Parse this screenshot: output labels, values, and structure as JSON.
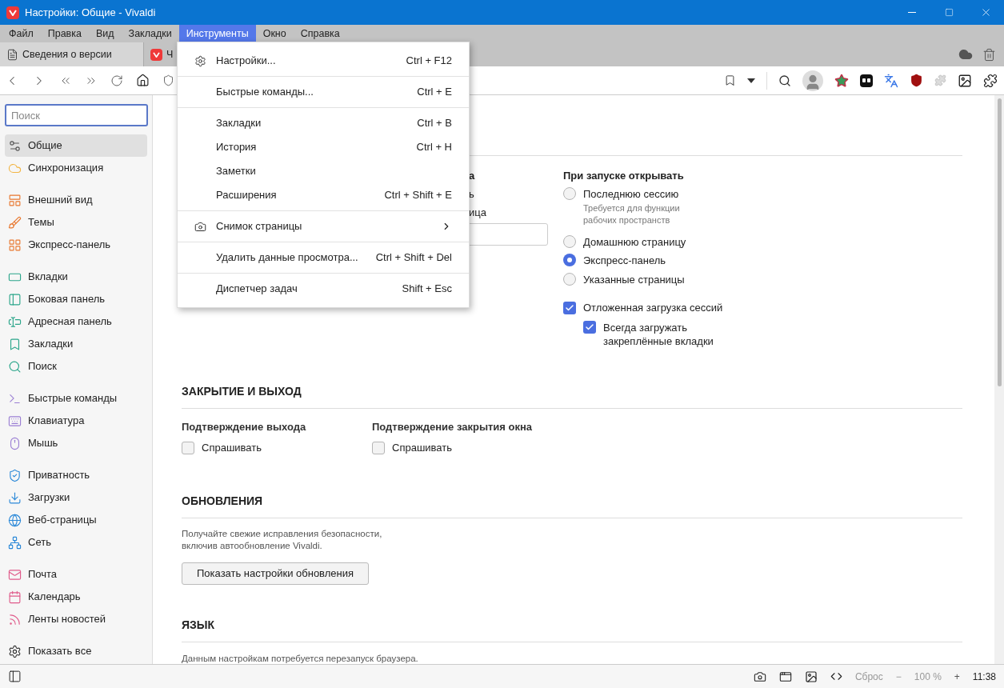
{
  "window": {
    "title": "Настройки: Общие - Vivaldi"
  },
  "menubar": [
    {
      "label": "Файл",
      "selected": false
    },
    {
      "label": "Правка",
      "selected": false
    },
    {
      "label": "Вид",
      "selected": false
    },
    {
      "label": "Закладки",
      "selected": false
    },
    {
      "label": "Инструменты",
      "selected": true
    },
    {
      "label": "Окно",
      "selected": false
    },
    {
      "label": "Справка",
      "selected": false
    }
  ],
  "tabs": [
    {
      "label": "Сведения о версии",
      "kind": "page",
      "selected": true
    },
    {
      "label": "Ч",
      "kind": "vivaldi",
      "selected": false
    }
  ],
  "menu": {
    "groups": [
      [
        {
          "label": "Настройки...",
          "shortcut": "Ctrl + F12",
          "kind": "settings",
          "submenu": false
        }
      ],
      [
        {
          "label": "Быстрые команды...",
          "shortcut": "Ctrl + E",
          "kind": "plain",
          "submenu": false
        }
      ],
      [
        {
          "label": "Закладки",
          "shortcut": "Ctrl + B",
          "kind": "plain",
          "submenu": false
        },
        {
          "label": "История",
          "shortcut": "Ctrl + H",
          "kind": "plain",
          "submenu": false
        },
        {
          "label": "Заметки",
          "kind": "plain",
          "submenu": false
        },
        {
          "label": "Расширения",
          "shortcut": "Ctrl + Shift + E",
          "kind": "plain",
          "submenu": false
        }
      ],
      [
        {
          "label": "Снимок страницы",
          "kind": "camera",
          "submenu": true
        }
      ],
      [
        {
          "label": "Удалить данные просмотра...",
          "shortcut": "Ctrl + Shift + Del",
          "kind": "plain",
          "submenu": false
        }
      ],
      [
        {
          "label": "Диспетчер задач",
          "shortcut": "Shift + Esc",
          "kind": "plain",
          "submenu": false
        }
      ]
    ]
  },
  "sidebar": {
    "search": {
      "placeholder": "Поиск"
    },
    "groups": [
      [
        {
          "label": "Общие",
          "selected": true
        },
        {
          "label": "Синхронизация",
          "selected": false
        }
      ],
      [
        {
          "label": "Внешний вид",
          "selected": false
        },
        {
          "label": "Темы",
          "selected": false
        },
        {
          "label": "Экспресс-панель",
          "selected": false
        }
      ],
      [
        {
          "label": "Вкладки",
          "selected": false
        },
        {
          "label": "Боковая панель",
          "selected": false
        },
        {
          "label": "Адресная панель",
          "selected": false
        },
        {
          "label": "Закладки",
          "selected": false
        },
        {
          "label": "Поиск",
          "selected": false
        }
      ],
      [
        {
          "label": "Быстрые команды",
          "selected": false
        },
        {
          "label": "Клавиатура",
          "selected": false
        },
        {
          "label": "Мышь",
          "selected": false
        }
      ],
      [
        {
          "label": "Приватность",
          "selected": false
        },
        {
          "label": "Загрузки",
          "selected": false
        },
        {
          "label": "Веб-страницы",
          "selected": false
        },
        {
          "label": "Сеть",
          "selected": false
        }
      ],
      [
        {
          "label": "Почта",
          "selected": false
        },
        {
          "label": "Календарь",
          "selected": false
        },
        {
          "label": "Ленты новостей",
          "selected": false
        }
      ],
      [
        {
          "label": "Показать все",
          "selected": false
        }
      ]
    ]
  },
  "startup": {
    "left_fragments": [
      "а",
      "ь",
      "ица"
    ],
    "title": "При запуске открывать",
    "options": [
      {
        "label": "Последнюю сессию",
        "note": "Требуется для функции рабочих пространств",
        "selected": false
      },
      {
        "label": "Домашнюю страницу",
        "selected": false
      },
      {
        "label": "Экспресс-панель",
        "selected": true
      },
      {
        "label": "Указанные страницы",
        "selected": false
      }
    ],
    "lazy_load": {
      "label": "Отложенная загрузка сессий",
      "checked": true,
      "child": {
        "label": "Всегда загружать закреплённые вкладки",
        "checked": true
      }
    }
  },
  "closing": {
    "title": "ЗАКРЫТИЕ И ВЫХОД",
    "groups": [
      {
        "title": "Подтверждение выхода",
        "label": "Спрашивать",
        "checked": false
      },
      {
        "title": "Подтверждение закрытия окна",
        "label": "Спрашивать",
        "checked": false
      }
    ]
  },
  "updates": {
    "title": "ОБНОВЛЕНИЯ",
    "text": "Получайте свежие исправления безопасности, включив автообновление Vivaldi.",
    "button": "Показать настройки обновления"
  },
  "language": {
    "title": "ЯЗЫК",
    "text": "Данным настройкам потребуется перезапуск браузера."
  },
  "status_bar": {
    "reset": "Сброс",
    "zoom_out": "−",
    "zoom": "100 %",
    "zoom_in": "+",
    "time": "11:38"
  }
}
